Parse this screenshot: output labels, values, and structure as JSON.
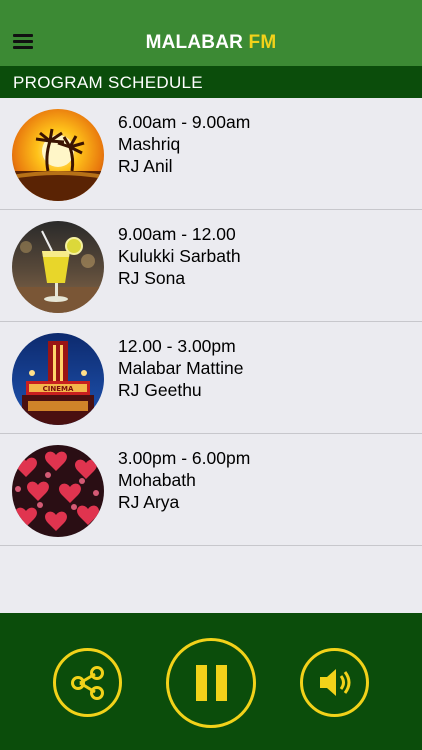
{
  "header": {
    "title_part1": "MALABAR",
    "title_part2": "FM",
    "menu_icon": "hamburger-menu-icon",
    "colors": {
      "bar": "#3c8a34",
      "accent": "#f2d21a"
    }
  },
  "section": {
    "title": "PROGRAM SCHEDULE",
    "color": "#0b4d0b"
  },
  "programs": [
    {
      "time": "6.00am - 9.00am",
      "name": "Mashriq",
      "host": "RJ Anil",
      "image": "sunset-palm-trees"
    },
    {
      "time": "9.00am - 12.00",
      "name": "Kulukki Sarbath",
      "host": "RJ Sona",
      "image": "lemon-juice-glass"
    },
    {
      "time": "12.00 - 3.00pm",
      "name": "Malabar Mattine",
      "host": "RJ Geethu",
      "image": "cinema-theater"
    },
    {
      "time": "3.00pm - 6.00pm",
      "name": "Mohabath",
      "host": "RJ Arya",
      "image": "red-hearts"
    }
  ],
  "player": {
    "share_icon": "share-icon",
    "pause_icon": "pause-icon",
    "volume_icon": "volume-icon"
  }
}
